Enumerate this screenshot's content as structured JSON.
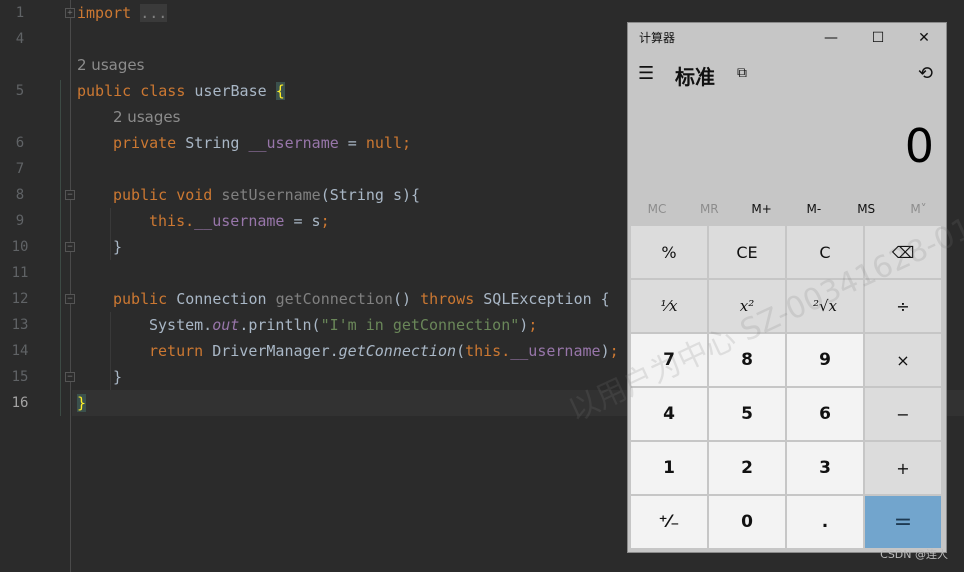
{
  "editor": {
    "line_numbers": [
      {
        "n": "1",
        "row": 0
      },
      {
        "n": "4",
        "row": 1
      },
      {
        "n": "5",
        "row": 3
      },
      {
        "n": "6",
        "row": 5
      },
      {
        "n": "7",
        "row": 6
      },
      {
        "n": "8",
        "row": 7
      },
      {
        "n": "9",
        "row": 8
      },
      {
        "n": "10",
        "row": 9
      },
      {
        "n": "11",
        "row": 10
      },
      {
        "n": "12",
        "row": 11
      },
      {
        "n": "13",
        "row": 12
      },
      {
        "n": "14",
        "row": 13
      },
      {
        "n": "15",
        "row": 14
      },
      {
        "n": "16",
        "row": 15,
        "current": true
      }
    ],
    "usages": [
      {
        "text": "2 usages",
        "row": 2,
        "indent": 0
      },
      {
        "text": "2 usages",
        "row": 4,
        "indent": 1
      }
    ],
    "lines": [
      {
        "row": 0,
        "indent": 0,
        "tokens": [
          {
            "t": "import ",
            "c": "kw"
          },
          {
            "t": "...",
            "c": "dots"
          }
        ]
      },
      {
        "row": 3,
        "indent": 0,
        "tokens": [
          {
            "t": "public class ",
            "c": "kw"
          },
          {
            "t": "userBase ",
            "c": "ty"
          },
          {
            "t": "{",
            "c": "brace"
          }
        ]
      },
      {
        "row": 5,
        "indent": 1,
        "tokens": [
          {
            "t": "private ",
            "c": "kw"
          },
          {
            "t": "String ",
            "c": "ty"
          },
          {
            "t": "__username",
            "c": "fd"
          },
          {
            "t": " = ",
            "c": "ty"
          },
          {
            "t": "null;",
            "c": "kw"
          }
        ]
      },
      {
        "row": 7,
        "indent": 1,
        "tokens": [
          {
            "t": "public void ",
            "c": "kw"
          },
          {
            "t": "setUsername",
            "c": "un"
          },
          {
            "t": "(String s){",
            "c": "ty"
          }
        ]
      },
      {
        "row": 8,
        "indent": 2,
        "tokens": [
          {
            "t": "this.",
            "c": "kw"
          },
          {
            "t": "__username",
            "c": "fd"
          },
          {
            "t": " = s",
            "c": "ty"
          },
          {
            "t": ";",
            "c": "kw"
          }
        ]
      },
      {
        "row": 9,
        "indent": 1,
        "tokens": [
          {
            "t": "}",
            "c": "ty"
          }
        ]
      },
      {
        "row": 11,
        "indent": 1,
        "tokens": [
          {
            "t": "public ",
            "c": "kw"
          },
          {
            "t": "Connection ",
            "c": "ty"
          },
          {
            "t": "getConnection",
            "c": "un"
          },
          {
            "t": "() ",
            "c": "ty"
          },
          {
            "t": "throws ",
            "c": "kw"
          },
          {
            "t": "SQLException {",
            "c": "ty"
          }
        ]
      },
      {
        "row": 12,
        "indent": 2,
        "tokens": [
          {
            "t": "System.",
            "c": "ty"
          },
          {
            "t": "out",
            "c": "fdi"
          },
          {
            "t": ".println(",
            "c": "ty"
          },
          {
            "t": "\"I'm in getConnection\"",
            "c": "st"
          },
          {
            "t": ")",
            "c": "ty"
          },
          {
            "t": ";",
            "c": "kw"
          }
        ]
      },
      {
        "row": 13,
        "indent": 2,
        "tokens": [
          {
            "t": "return ",
            "c": "kw"
          },
          {
            "t": "DriverManager.",
            "c": "ty"
          },
          {
            "t": "getConnection",
            "c": "it"
          },
          {
            "t": "(",
            "c": "ty"
          },
          {
            "t": "this.",
            "c": "kw"
          },
          {
            "t": "__username",
            "c": "fd"
          },
          {
            "t": ")",
            "c": "ty"
          },
          {
            "t": ";",
            "c": "kw"
          }
        ]
      },
      {
        "row": 14,
        "indent": 1,
        "tokens": [
          {
            "t": "}",
            "c": "ty"
          }
        ]
      },
      {
        "row": 15,
        "indent": 0,
        "tokens": [
          {
            "t": "}",
            "c": "brace"
          }
        ]
      }
    ]
  },
  "calculator": {
    "window_title": "计算器",
    "mode_title": "标准",
    "display_value": "0",
    "window_buttons": {
      "minimize": "—",
      "maximize": "☐",
      "close": "✕"
    },
    "icons": {
      "menu": "☰",
      "keep_on_top": "⧉",
      "history": "⟲"
    },
    "memory": [
      {
        "label": "MC",
        "enabled": false
      },
      {
        "label": "MR",
        "enabled": false
      },
      {
        "label": "M+",
        "enabled": true
      },
      {
        "label": "M-",
        "enabled": true
      },
      {
        "label": "MS",
        "enabled": true
      },
      {
        "label": "M˅",
        "enabled": false
      }
    ],
    "keys": [
      [
        {
          "label": "%",
          "type": "fn"
        },
        {
          "label": "CE",
          "type": "fn"
        },
        {
          "label": "C",
          "type": "fn"
        },
        {
          "label": "⌫",
          "type": "fn"
        }
      ],
      [
        {
          "label": "¹⁄x",
          "type": "fn",
          "serif": true
        },
        {
          "label": "x²",
          "type": "fn",
          "serif": true
        },
        {
          "label": "²√x",
          "type": "fn",
          "serif": true
        },
        {
          "label": "÷",
          "type": "fn"
        }
      ],
      [
        {
          "label": "7",
          "type": "num"
        },
        {
          "label": "8",
          "type": "num"
        },
        {
          "label": "9",
          "type": "num"
        },
        {
          "label": "×",
          "type": "fn"
        }
      ],
      [
        {
          "label": "4",
          "type": "num"
        },
        {
          "label": "5",
          "type": "num"
        },
        {
          "label": "6",
          "type": "num"
        },
        {
          "label": "−",
          "type": "fn"
        }
      ],
      [
        {
          "label": "1",
          "type": "num"
        },
        {
          "label": "2",
          "type": "num"
        },
        {
          "label": "3",
          "type": "num"
        },
        {
          "label": "+",
          "type": "fn"
        }
      ],
      [
        {
          "label": "⁺⁄₋",
          "type": "num"
        },
        {
          "label": "0",
          "type": "num"
        },
        {
          "label": ".",
          "type": "num"
        },
        {
          "label": "=",
          "type": "eq"
        }
      ]
    ]
  },
  "watermark": "以用户为中心 SZ-00341628-01, luzhe.lian",
  "credit": "CSDN @连人"
}
